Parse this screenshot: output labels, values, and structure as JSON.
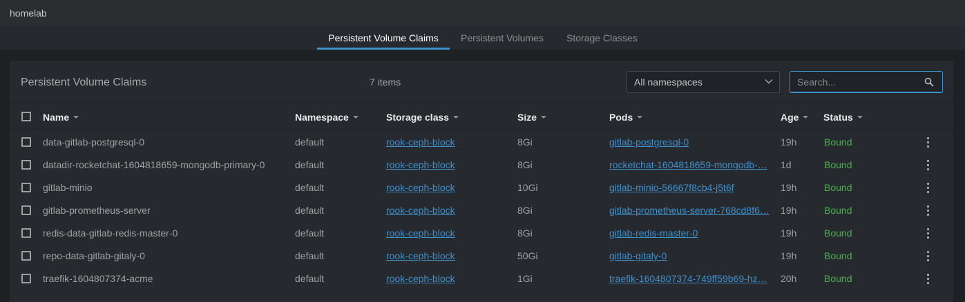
{
  "window": {
    "title": "homelab"
  },
  "tabs": [
    {
      "label": "Persistent Volume Claims",
      "active": true
    },
    {
      "label": "Persistent Volumes",
      "active": false
    },
    {
      "label": "Storage Classes",
      "active": false
    }
  ],
  "panel": {
    "title": "Persistent Volume Claims",
    "items_count": "7 items",
    "namespace_select": {
      "value": "All namespaces",
      "icon": "chevron-down-icon"
    },
    "search": {
      "placeholder": "Search...",
      "value": "",
      "icon": "search-icon"
    }
  },
  "table": {
    "columns": [
      "Name",
      "Namespace",
      "Storage class",
      "Size",
      "Pods",
      "Age",
      "Status"
    ],
    "rows": [
      {
        "name": "data-gitlab-postgresql-0",
        "namespace": "default",
        "storage_class": "rook-ceph-block",
        "size": "8Gi",
        "pods": "gitlab-postgresql-0",
        "age": "19h",
        "status": "Bound"
      },
      {
        "name": "datadir-rocketchat-1604818659-mongodb-primary-0",
        "namespace": "default",
        "storage_class": "rook-ceph-block",
        "size": "8Gi",
        "pods": "rocketchat-1604818659-mongodb-…",
        "age": "1d",
        "status": "Bound"
      },
      {
        "name": "gitlab-minio",
        "namespace": "default",
        "storage_class": "rook-ceph-block",
        "size": "10Gi",
        "pods": "gitlab-minio-56667f8cb4-j5t6f",
        "age": "19h",
        "status": "Bound"
      },
      {
        "name": "gitlab-prometheus-server",
        "namespace": "default",
        "storage_class": "rook-ceph-block",
        "size": "8Gi",
        "pods": "gitlab-prometheus-server-768cd8f6…",
        "age": "19h",
        "status": "Bound"
      },
      {
        "name": "redis-data-gitlab-redis-master-0",
        "namespace": "default",
        "storage_class": "rook-ceph-block",
        "size": "8Gi",
        "pods": "gitlab-redis-master-0",
        "age": "19h",
        "status": "Bound"
      },
      {
        "name": "repo-data-gitlab-gitaly-0",
        "namespace": "default",
        "storage_class": "rook-ceph-block",
        "size": "50Gi",
        "pods": "gitlab-gitaly-0",
        "age": "19h",
        "status": "Bound"
      },
      {
        "name": "traefik-1604807374-acme",
        "namespace": "default",
        "storage_class": "rook-ceph-block",
        "size": "1Gi",
        "pods": "traefik-1604807374-749ff59b69-hz…",
        "age": "20h",
        "status": "Bound"
      }
    ]
  },
  "colors": {
    "accent": "#3d90ce",
    "status_bound": "#4caf50",
    "background": "#1e2124",
    "panel": "#262a2e"
  }
}
